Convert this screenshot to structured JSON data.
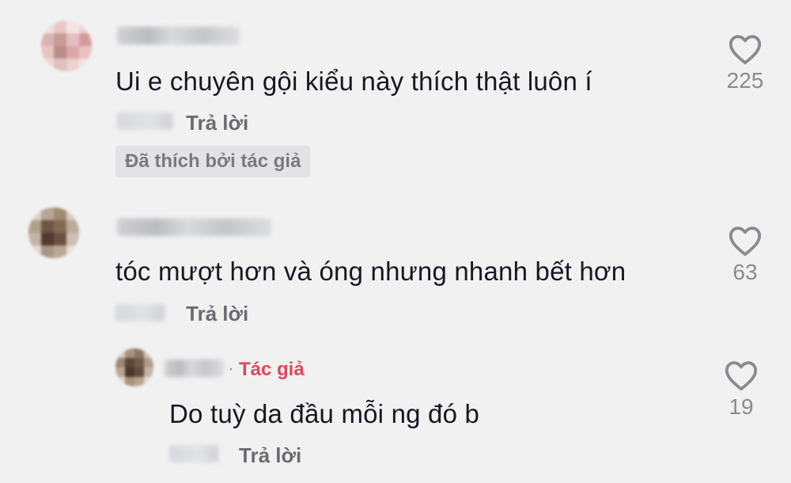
{
  "comments": [
    {
      "text": "Ui e chuyên gội kiểu này thích thật luôn í",
      "reply_label": "Trả lời",
      "liked_by_author_label": "Đã thích bởi tác giả",
      "like_count": "225",
      "like_icon": "heart-outline-icon"
    },
    {
      "text": "tóc mượt hơn và óng nhưng nhanh bết hơn",
      "reply_label": "Trả lời",
      "like_count": "63",
      "like_icon": "heart-outline-icon",
      "replies": [
        {
          "author_tag": "Tác giả",
          "text": "Do tuỳ da đầu mỗi ng đó b",
          "reply_label": "Trả lời",
          "like_count": "19",
          "like_icon": "heart-outline-icon"
        }
      ]
    }
  ],
  "colors": {
    "background": "#f1f1f2",
    "text": "#161823",
    "muted": "#6b6c72",
    "author_accent": "#e0475a"
  }
}
